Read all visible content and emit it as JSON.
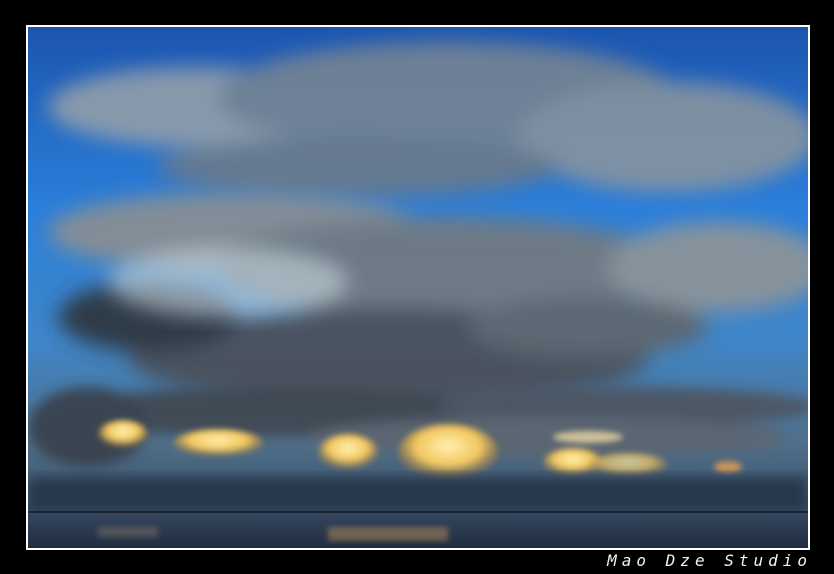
{
  "image": {
    "subject": "sky-over-sea",
    "colors": {
      "frame": "#000000",
      "border": "#ffffff",
      "sky_top": "#1f5fbf",
      "sky_mid": "#2f86df",
      "cloud_dark": "#2f3540",
      "cloud_mid": "#6f7c8a",
      "cloud_light": "#c8c9c4",
      "sunlit_cloud": "#f4d37a",
      "sea": "#2a3d55"
    }
  },
  "watermark": {
    "text": "Mao Dze Studio"
  }
}
